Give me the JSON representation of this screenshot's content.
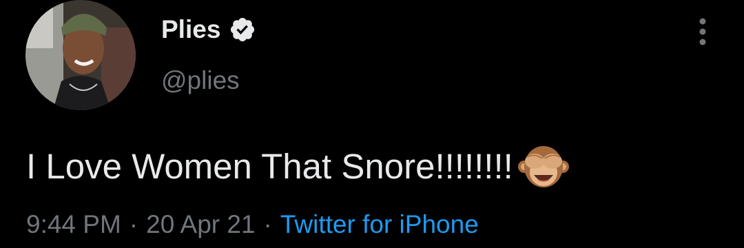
{
  "user": {
    "display_name": "Plies",
    "handle": "@plies",
    "verified": true
  },
  "tweet": {
    "text": "I Love Women That Snore!!!!!!!!",
    "emoji": "see-no-evil-monkey"
  },
  "meta": {
    "time": "9:44 PM",
    "separator": "·",
    "date": "20 Apr 21",
    "source": "Twitter for iPhone"
  },
  "icons": {
    "more": "more-vertical-icon",
    "verified": "verified-badge-icon"
  },
  "colors": {
    "background": "#000000",
    "primary_text": "#e7e9ea",
    "secondary_text": "#71767b",
    "link": "#1d9bf0"
  }
}
